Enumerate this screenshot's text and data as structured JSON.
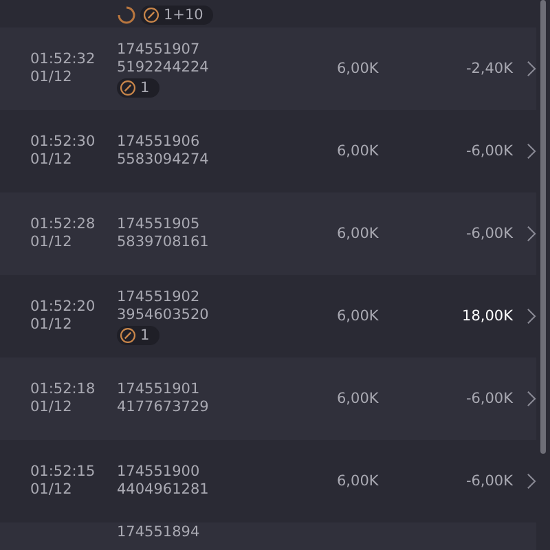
{
  "top_partial_row": {
    "spinner": true,
    "badge": {
      "count": "1+10"
    }
  },
  "rows": [
    {
      "time": "01:52:32",
      "date": "01/12",
      "round": "174551907",
      "ticket": "5192244224",
      "badge": {
        "count": "1"
      },
      "stake": "6,00K",
      "result": "-2,40K",
      "win": false
    },
    {
      "time": "01:52:30",
      "date": "01/12",
      "round": "174551906",
      "ticket": "5583094274",
      "stake": "6,00K",
      "result": "-6,00K",
      "win": false
    },
    {
      "time": "01:52:28",
      "date": "01/12",
      "round": "174551905",
      "ticket": "5839708161",
      "stake": "6,00K",
      "result": "-6,00K",
      "win": false
    },
    {
      "time": "01:52:20",
      "date": "01/12",
      "round": "174551902",
      "ticket": "3954603520",
      "badge": {
        "count": "1"
      },
      "stake": "6,00K",
      "result": "18,00K",
      "win": true
    },
    {
      "time": "01:52:18",
      "date": "01/12",
      "round": "174551901",
      "ticket": "4177673729",
      "stake": "6,00K",
      "result": "-6,00K",
      "win": false
    },
    {
      "time": "01:52:15",
      "date": "01/12",
      "round": "174551900",
      "ticket": "4404961281",
      "stake": "6,00K",
      "result": "-6,00K",
      "win": false
    }
  ],
  "bottom_partial_row": {
    "round": "174551894"
  }
}
